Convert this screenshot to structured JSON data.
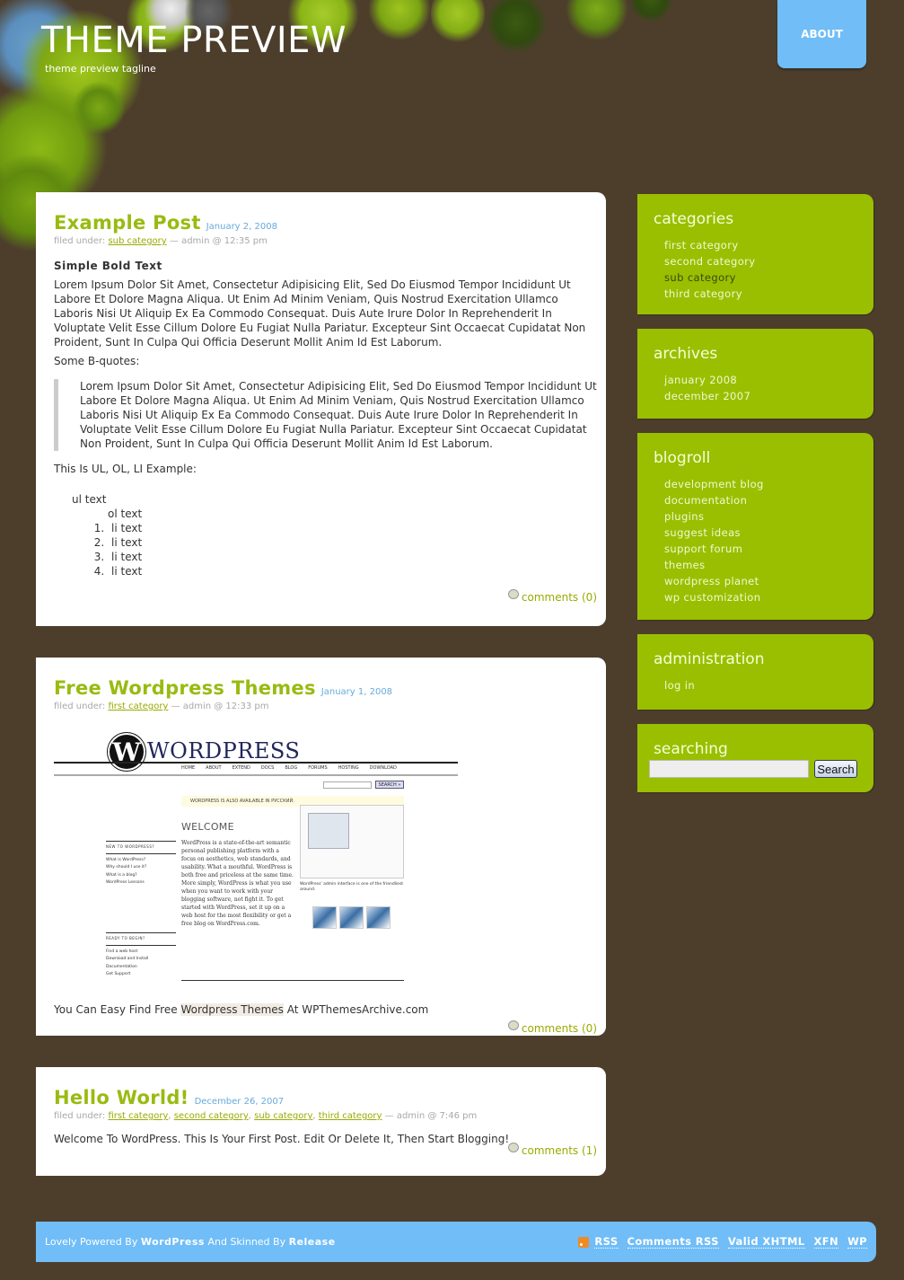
{
  "header": {
    "title": "THEME PREVIEW",
    "tagline": "theme preview tagline",
    "nav": [
      {
        "label": "ABOUT"
      }
    ]
  },
  "posts": [
    {
      "title": "Example Post",
      "date": "January 2, 2008",
      "meta_prefix": "filed under:",
      "categories": [
        "sub category"
      ],
      "meta_suffix": "— admin @ 12:35 pm",
      "bold_heading": "Simple Bold Text",
      "paragraph": "Lorem Ipsum Dolor Sit Amet, Consectetur Adipisicing Elit, Sed Do Eiusmod Tempor Incididunt Ut Labore Et Dolore Magna Aliqua. Ut Enim Ad Minim Veniam, Quis Nostrud Exercitation Ullamco Laboris Nisi Ut Aliquip Ex Ea Commodo Consequat. Duis Aute Irure Dolor In Reprehenderit In Voluptate Velit Esse Cillum Dolore Eu Fugiat Nulla Pariatur. Excepteur Sint Occaecat Cupidatat Non Proident, Sunt In Culpa Qui Officia Deserunt Mollit Anim Id Est Laborum.",
      "bquote_label": "Some B-quotes:",
      "blockquote": "Lorem Ipsum Dolor Sit Amet, Consectetur Adipisicing Elit, Sed Do Eiusmod Tempor Incididunt Ut Labore Et Dolore Magna Aliqua. Ut Enim Ad Minim Veniam, Quis Nostrud Exercitation Ullamco Laboris Nisi Ut Aliquip Ex Ea Commodo Consequat. Duis Aute Irure Dolor In Reprehenderit In Voluptate Velit Esse Cillum Dolore Eu Fugiat Nulla Pariatur. Excepteur Sint Occaecat Cupidatat Non Proident, Sunt In Culpa Qui Officia Deserunt Mollit Anim Id Est Laborum.",
      "list_label": "This Is UL, OL, LI Example:",
      "ul_text": "ul text",
      "ol_text": "ol text",
      "li_items": [
        "li text",
        "li text",
        "li text",
        "li text"
      ],
      "comments": "comments (0)"
    },
    {
      "title": "Free Wordpress Themes",
      "date": "January 1, 2008",
      "meta_prefix": "filed under:",
      "categories": [
        "first category"
      ],
      "meta_suffix": "— admin @ 12:33 pm",
      "image": {
        "logo_letter": "W",
        "logo_text": "WORDPRESS",
        "nav": [
          "HOME",
          "ABOUT",
          "EXTEND",
          "DOCS",
          "BLOG",
          "FORUMS",
          "HOSTING",
          "DOWNLOAD"
        ],
        "search_btn": "SEARCH »",
        "notice": "WORDPRESS IS ALSO AVAILABLE IN РУССКИЙ.",
        "welcome": "WELCOME",
        "intro": "WordPress is a state-of-the-art semantic personal publishing platform with a focus on aesthetics, web standards, and usability. What a mouthful. WordPress is both free and priceless at the same time. More simply, WordPress is what you use when you want to work with your blogging software, not fight it. To get started with WordPress, set it up on a web host for the most flexibility or get a free blog on WordPress.com.",
        "side1_title": "NEW TO WORDPRESS?",
        "side1_items": [
          "What is WordPress?",
          "Why should I use it?",
          "What is a blog?",
          "WordPress Lessons"
        ],
        "side2_title": "READY TO BEGIN?",
        "side2_items": [
          "Find a web host",
          "Download and Install",
          "Documentation",
          "Get Support"
        ],
        "theme_caption": "WordPress' admin interface is one of the friendliest around."
      },
      "body_before": "You Can Easy Find Free ",
      "body_highlight": "Wordpress Themes",
      "body_after": " At WPThemesArchive.com",
      "comments": "comments (0)"
    },
    {
      "title": "Hello World!",
      "date": "December 26, 2007",
      "meta_prefix": "filed under:",
      "categories": [
        "first category",
        "second category",
        "sub category",
        "third category"
      ],
      "meta_suffix": "— admin @ 7:46 pm",
      "body": "Welcome To WordPress. This Is Your First Post. Edit Or Delete It, Then Start Blogging!",
      "comments": "comments (1)"
    }
  ],
  "sidebar": {
    "categories": {
      "title": "categories",
      "items": [
        "first category",
        "second category",
        "sub category",
        "third category"
      ],
      "current": "sub category"
    },
    "archives": {
      "title": "archives",
      "items": [
        "january 2008",
        "december 2007"
      ]
    },
    "blogroll": {
      "title": "blogroll",
      "items": [
        "development blog",
        "documentation",
        "plugins",
        "suggest ideas",
        "support forum",
        "themes",
        "wordpress planet",
        "wp customization"
      ]
    },
    "administration": {
      "title": "administration",
      "items": [
        "log in"
      ]
    },
    "searching": {
      "title": "searching",
      "input_value": "",
      "button": "Search"
    }
  },
  "footer": {
    "left_prefix": "Lovely Powered By ",
    "left_brand": "WordPress",
    "left_mid": " And Skinned By ",
    "left_skin": "Release",
    "links": [
      "RSS",
      "Comments RSS",
      "Valid XHTML",
      "XFN",
      "WP"
    ]
  },
  "colors": {
    "background": "#4d3e2c",
    "accent_green": "#99bf00",
    "accent_blue": "#70bdf7",
    "title_green": "#99bb11",
    "date_blue": "#66aadd"
  }
}
